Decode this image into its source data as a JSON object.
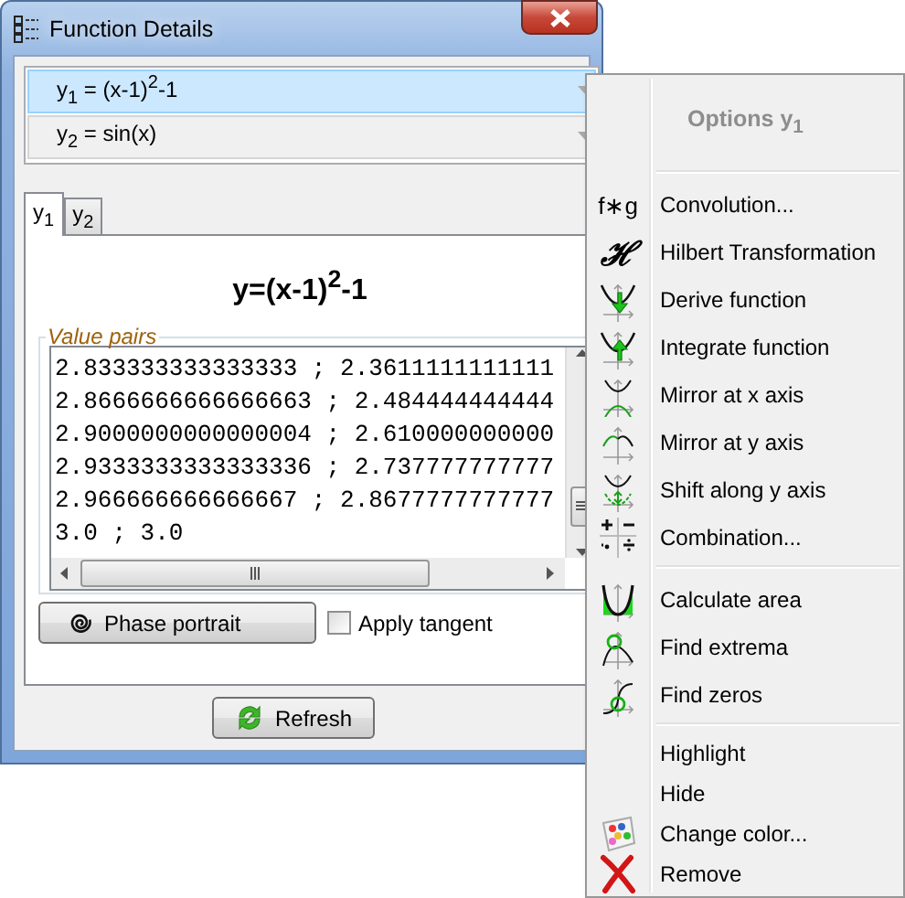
{
  "window": {
    "title": "Function Details"
  },
  "functions": [
    {
      "label": "y$_{1}$ = (x-1)$^{2}$-1",
      "selected": true
    },
    {
      "label": "y$_{2}$ = sin(x)",
      "selected": false
    }
  ],
  "tabs": [
    {
      "label": "y$_{1}$",
      "selected": true
    },
    {
      "label": "y$_{2}$",
      "selected": false
    }
  ],
  "formula": "y=(x-1)$^{2}$-1",
  "value_pairs": {
    "legend": "Value pairs",
    "lines": [
      "2.833333333333333 ; 2.3611111111111",
      "2.8666666666666663 ; 2.484444444444",
      "2.9000000000000004 ; 2.610000000000",
      "2.9333333333333336 ; 2.737777777777",
      "2.966666666666667 ; 2.8677777777777",
      "3.0 ; 3.0"
    ]
  },
  "phase_button": "Phase portrait",
  "apply_tangent": {
    "label": "Apply tangent",
    "checked": false
  },
  "refresh_button": "Refresh",
  "context_menu": {
    "title": "Options y$_{1}$",
    "groups": [
      [
        {
          "label": "Convolution...",
          "kind": "glyph",
          "glyph": "f∗g"
        },
        {
          "label": "Hilbert Transformation",
          "kind": "glyph",
          "glyph": "ℋ"
        },
        {
          "label": "Derive function",
          "kind": "derive"
        },
        {
          "label": "Integrate function",
          "kind": "integrate"
        },
        {
          "label": "Mirror at x axis",
          "kind": "mirrorx"
        },
        {
          "label": "Mirror at y axis",
          "kind": "mirrory"
        },
        {
          "label": "Shift along y axis",
          "kind": "shift"
        },
        {
          "label": "Combination...",
          "kind": "combine"
        }
      ],
      [
        {
          "label": "Calculate area",
          "kind": "area"
        },
        {
          "label": "Find extrema",
          "kind": "extrema"
        },
        {
          "label": "Find zeros",
          "kind": "zeros"
        }
      ],
      [
        {
          "label": "Highlight",
          "kind": "plain"
        },
        {
          "label": "Hide",
          "kind": "plain"
        },
        {
          "label": "Change color...",
          "kind": "palette"
        },
        {
          "label": "Remove",
          "kind": "remove"
        }
      ]
    ]
  }
}
